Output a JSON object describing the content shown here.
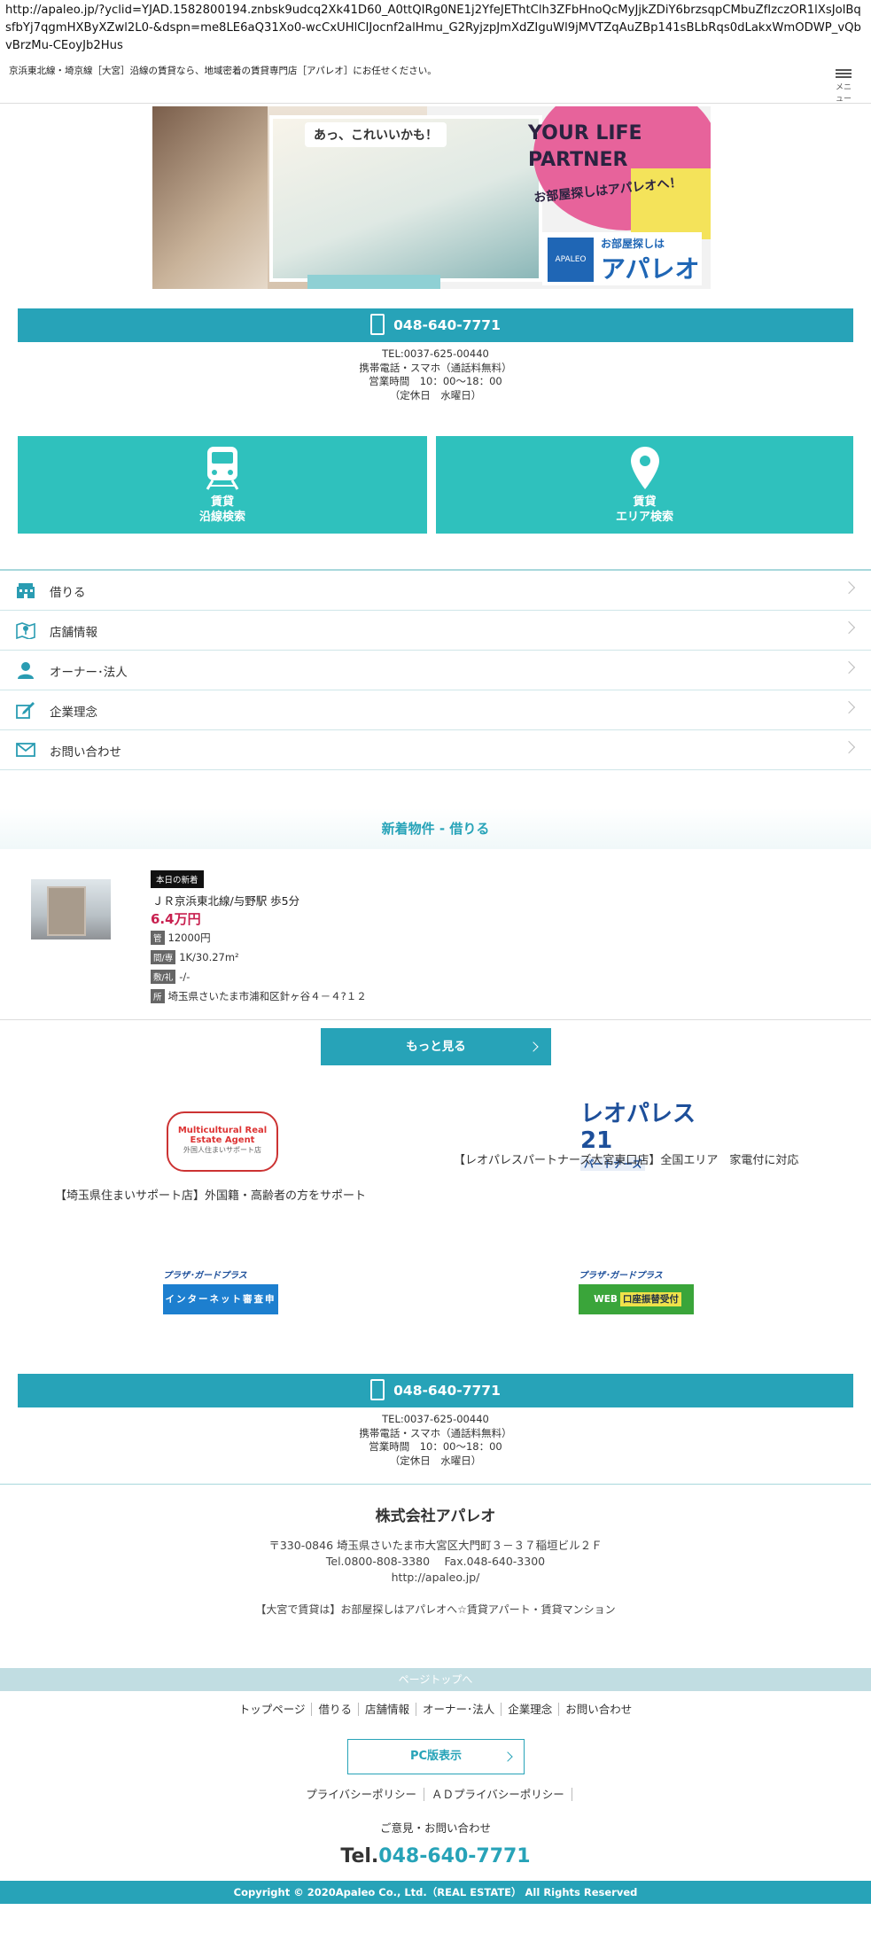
{
  "url": "http://apaleo.jp/?yclid=YJAD.1582800194.znbsk9udcq2Xk41D60_A0ttQIRg0NE1j2YfeJEThtClh3ZFbHnoQcMyJjkZDiY6brzsqpCMbuZfIzczOR1lXsJolBqsfbYj7qgmHXByXZwl2L0-&dspn=me8LE6aQ31Xo0-wcCxUHlCIJocnf2alHmu_G2RyjzpJmXdZIguWl9jMVTZqAuZBp141sBLbRqs0dLakxWmODWP_vQbvBrzMu-CEoyJb2Hus",
  "header": {
    "tagline": "京浜東北線・埼京線［大宮］沿線の賃貸なら、地域密着の賃貸専門店［アパレオ］にお任せください。",
    "menu_label": "メニュー"
  },
  "hero": {
    "speech": "あっ、これいいかも！",
    "headline_1": "YOUR LIFE",
    "headline_2": "PARTNER",
    "sub": "お部屋探しはアパレオへ！",
    "logo_small": "お部屋探しは",
    "logo_big": "アパレオ",
    "logo_mark": "APALEO"
  },
  "tel": {
    "number": "048-640-7771",
    "line1": "TEL:0037-625-00440",
    "line2": "携帯電話・スマホ（通話料無料）",
    "line3": "営業時間　10：00〜18：00",
    "line4": "（定休日　水曜日）"
  },
  "tiles": [
    {
      "l1": "賃貸",
      "l2": "沿線検索"
    },
    {
      "l1": "賃貸",
      "l2": "エリア検索"
    }
  ],
  "nav": [
    {
      "label": "借りる"
    },
    {
      "label": "店舗情報"
    },
    {
      "label": "オーナー･法人"
    },
    {
      "label": "企業理念"
    },
    {
      "label": "お問い合わせ"
    }
  ],
  "new_section": {
    "title": "新着物件 - 借りる"
  },
  "property": {
    "badge": "本日の新着",
    "station": "ＪＲ京浜東北線/与野駅 歩5分",
    "price": "6.4万円",
    "mgmt_key": "管",
    "mgmt": "12000円",
    "layout_key": "間/専",
    "layout": "1K/30.27m²",
    "deposit_key": "敷/礼",
    "deposit": "-/-",
    "address_key": "所",
    "address": "埼玉県さいたま市浦和区針ヶ谷４－４?１２"
  },
  "more_button": "もっと見る",
  "partners": {
    "mc_title": "Multicultural Real Estate Agent",
    "mc_sub": "外国人住まいサポート店",
    "mc_caption": "【埼玉県住まいサポート店】外国籍・高齢者の方をサポート",
    "leo_title": "レオパレス21",
    "leo_sub": "パートナーズ",
    "leo_caption": "【レオパレスパートナーズ大宮東口店】全国エリア　家電付に対応",
    "gp_title": "プラザ･ガードプラス",
    "gp_box1": "インターネット審査申込",
    "gp_box2_pre": "WEB",
    "gp_box2_hl": "口座振替受付"
  },
  "company": {
    "name": "株式会社アパレオ",
    "address": "〒330-0846 埼玉県さいたま市大宮区大門町３－３７稲垣ビル２Ｆ",
    "tel_fax": "Tel.0800-808-3380　 Fax.048-640-3300",
    "url": "http://apaleo.jp/",
    "slogan": "【大宮で賃貸は】お部屋探しはアパレオへ☆賃貸アパート・賃貸マンション"
  },
  "footer": {
    "page_top": "ページトップへ",
    "links": [
      "トップページ",
      "借りる",
      "店舗情報",
      "オーナー･法人",
      "企業理念",
      "お問い合わせ"
    ],
    "pc_view": "PC版表示",
    "policy_1": "プライバシーポリシー",
    "policy_2": "ＡＤプライバシーポリシー",
    "inquiry": "ご意見・お問い合わせ",
    "big_tel_prefix": "Tel.",
    "big_tel_number": "048-640-7771",
    "copyright": "Copyright © 2020Apaleo Co., Ltd.（REAL ESTATE） All Rights Reserved"
  },
  "colors": {
    "teal": "#27a3b8",
    "tile": "#2fc1bd",
    "price": "#c8204f"
  }
}
